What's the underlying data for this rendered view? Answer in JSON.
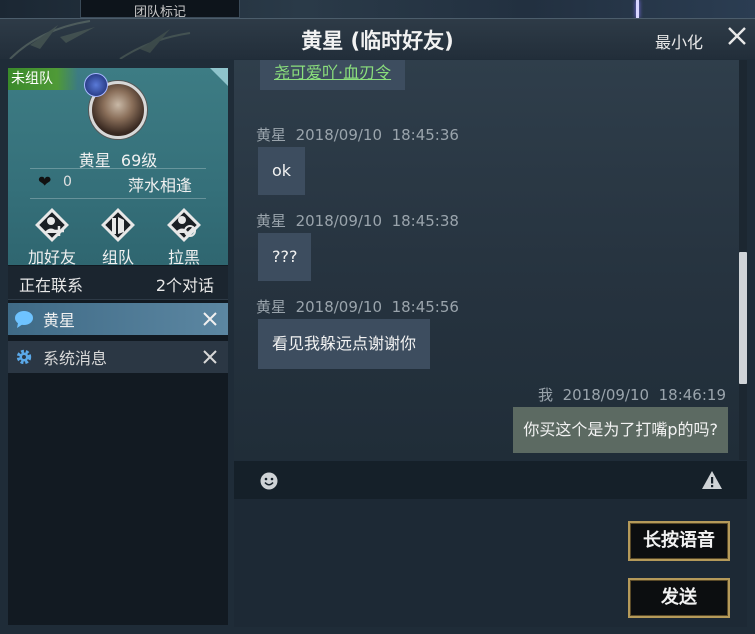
{
  "top_strip": {
    "tab_label": "团队标记"
  },
  "window": {
    "title": "黄星 (临时好友)",
    "minimize_label": "最小化"
  },
  "profile": {
    "team_badge": "未组队",
    "name": "黄星",
    "level": "69级",
    "intimacy": "0",
    "relation": "萍水相逢",
    "actions": [
      {
        "label": "加好友",
        "icon": "add-friend-icon"
      },
      {
        "label": "组队",
        "icon": "team-icon"
      },
      {
        "label": "拉黑",
        "icon": "block-icon"
      }
    ]
  },
  "contacts": {
    "status_label": "正在联系",
    "conversation_count": "2个对话",
    "items": [
      {
        "name": "黄星",
        "icon": "chat-bubble-icon",
        "active": true
      },
      {
        "name": "系统消息",
        "icon": "gear-icon",
        "active": false
      }
    ]
  },
  "messages": [
    {
      "sender": "",
      "date": "",
      "time": "",
      "text": "尧可爱吖·血刃令",
      "type": "link"
    },
    {
      "sender": "黄星",
      "date": "2018/09/10",
      "time": "18:45:36",
      "text": "ok",
      "type": "received"
    },
    {
      "sender": "黄星",
      "date": "2018/09/10",
      "time": "18:45:38",
      "text": "???",
      "type": "received"
    },
    {
      "sender": "黄星",
      "date": "2018/09/10",
      "time": "18:45:56",
      "text": "看见我躲远点谢谢你",
      "type": "received"
    },
    {
      "sender": "我",
      "date": "2018/09/10",
      "time": "18:46:19",
      "text": "你买这个是为了打嘴p的吗?",
      "type": "sent"
    }
  ],
  "toolbar": {
    "emoji_icon": "smile-icon",
    "report_icon": "warning-icon"
  },
  "buttons": {
    "voice_label": "长按语音",
    "send_label": "发送"
  },
  "colors": {
    "accent_gold": "#b59a5a",
    "link_green": "#8be07c",
    "badge_green": "#4f9a37"
  }
}
